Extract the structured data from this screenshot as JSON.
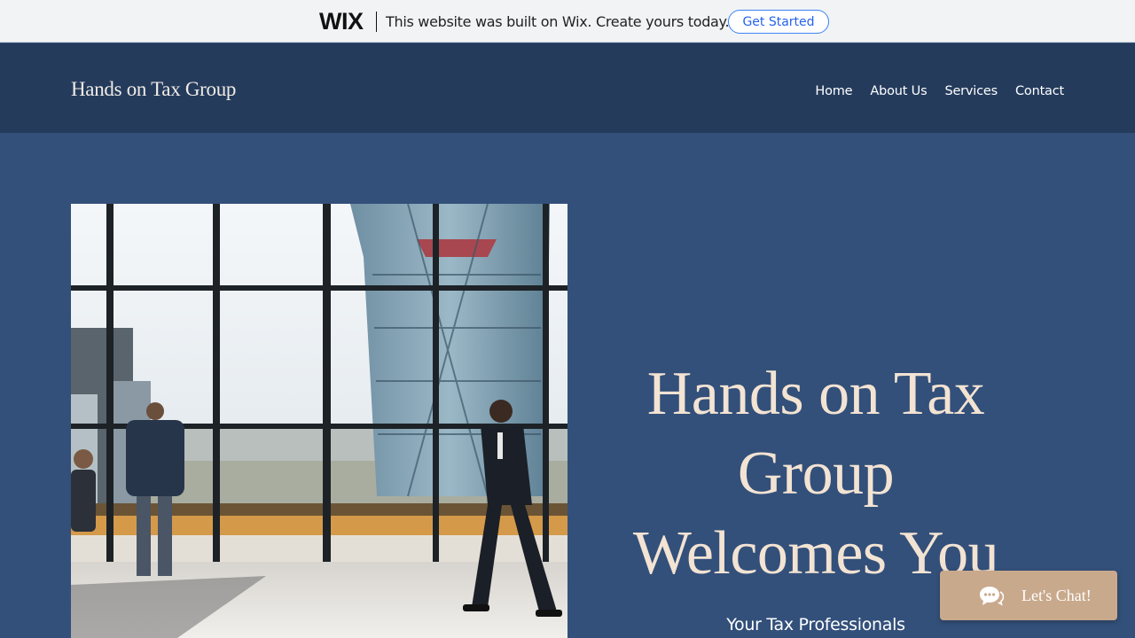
{
  "wix_banner": {
    "logo": "WIX",
    "message": "This website was built on Wix. Create yours today.",
    "cta_label": "Get Started"
  },
  "header": {
    "site_title": "Hands on Tax Group",
    "nav": [
      {
        "label": "Home"
      },
      {
        "label": "About Us"
      },
      {
        "label": "Services"
      },
      {
        "label": "Contact"
      }
    ]
  },
  "hero": {
    "headline_line1": "Hands on Tax",
    "headline_line2": "Group",
    "headline_line3": "Welcomes You",
    "subline": "Your Tax Professionals",
    "image_icon": "office-window-photo"
  },
  "chat": {
    "label": "Let's Chat!",
    "icon": "chat-bubbles-icon"
  },
  "colors": {
    "page_bg": "#33507a",
    "header_bg": "#243b5c",
    "headline": "#f3e3d3",
    "chat_bg": "#c9a98c",
    "wix_accent": "#2563eb"
  }
}
